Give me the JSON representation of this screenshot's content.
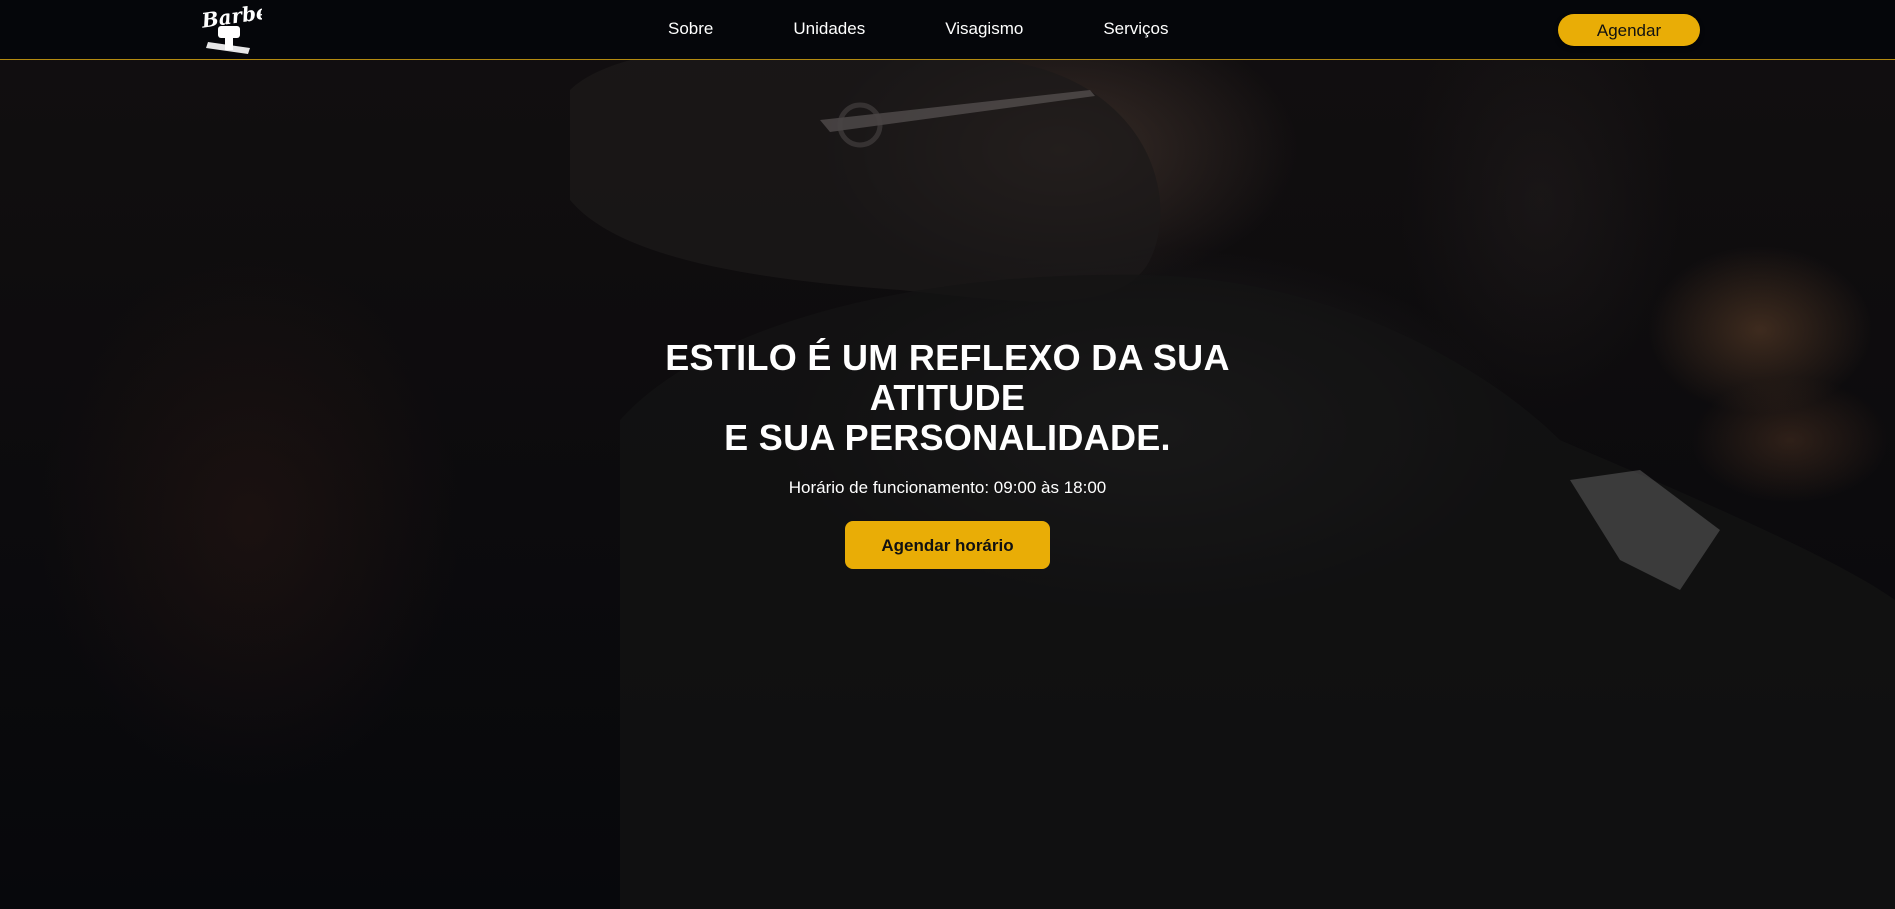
{
  "brand": {
    "logo_text": "Barber",
    "accent_color": "#e9ad06"
  },
  "nav": {
    "items": [
      {
        "label": "Sobre"
      },
      {
        "label": "Unidades"
      },
      {
        "label": "Visagismo"
      },
      {
        "label": "Serviços"
      }
    ],
    "cta_label": "Agendar"
  },
  "hero": {
    "title_lines": [
      "ESTILO É UM REFLEXO DA SUA ATITUDE",
      "E SUA PERSONALIDADE."
    ],
    "hours": "Horário de funcionamento: 09:00 às 18:00",
    "button_label": "Agendar horário"
  },
  "icons": [
    "barber-logo-icon"
  ]
}
